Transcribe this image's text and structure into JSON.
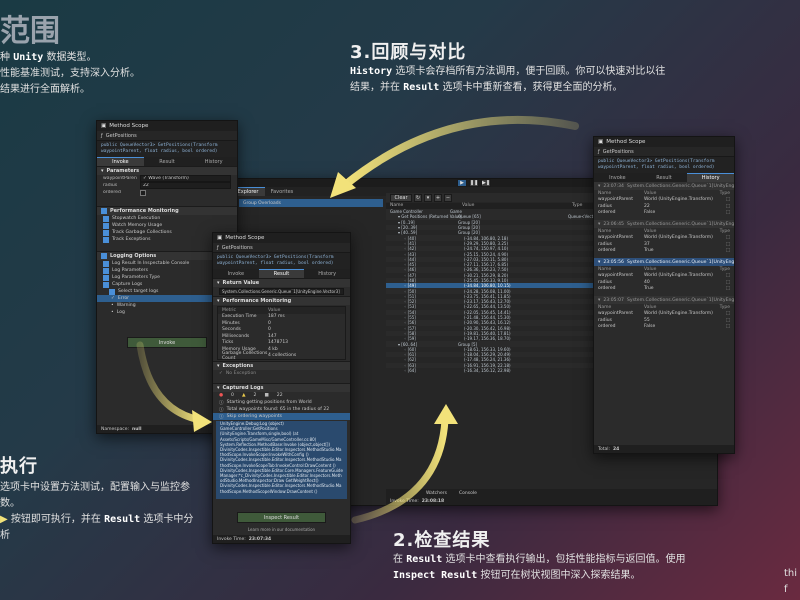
{
  "promo": {
    "corner_heading": "范围",
    "corner_line1_tail": "种",
    "corner_line1_unity": "Unity",
    "corner_line1_rest": "数据类型。",
    "corner_line2": "性能基准测试，支持深入分析。",
    "corner_line3": "结果进行全面解析。",
    "step3_title": "3.回顾与对比",
    "step3_kw1": "History",
    "step3_text1": " 选项卡会存档所有方法调用，便于回顾。你可以快速对比以往",
    "step3_text2a": "结果，并在 ",
    "step3_kw2": "Result",
    "step3_text2b": " 选项卡中重新查看，获得更全面的分析。",
    "step1_title": "执行",
    "step1_line1": "选项卡中设置方法测试，配置输入与监控参数。",
    "step1_line2a": "按钮即可执行，并在 ",
    "step1_kw": "Result",
    "step1_line2b": " 选项卡中分析",
    "step2_title": "2.检查结果",
    "step2_text1a": "在 ",
    "step2_kw1": "Result",
    "step2_text1b": " 选项卡中查看执行输出，包括性能指标与返回值。使用",
    "step2_kw2": "Inspect Result",
    "step2_text2": " 按钮可在树状视图中深入探索结果。",
    "corner_br1": "thi",
    "corner_br2": "f"
  },
  "invoke_window": {
    "title": "Method Scope",
    "method": "GetPositions",
    "code_line1": "public QueueVector3> GetPositions(Transform",
    "code_line2": "waypointParent, float radius, bool ordered)",
    "tabs": [
      "Invoke",
      "Result",
      "History"
    ],
    "parameters_label": "Parameters",
    "params": [
      {
        "name": "waypointParent",
        "value": "✓ Wave (Transform)"
      },
      {
        "name": "radius",
        "value": "22"
      },
      {
        "name": "ordered",
        "value": ""
      }
    ],
    "perf_label": "Performance Monitoring",
    "perf_options": [
      "Stopwatch Execution",
      "Watch Memory Usage",
      "Track Garbage Collections",
      "Track Exceptions"
    ],
    "logging_label": "Logging Options",
    "logging_options": [
      "Log Result In Inspectable Console",
      "Log Parameters",
      "Log Parameters Type",
      "Capture Logs"
    ],
    "select_logs": "Select target logs",
    "log_levels": [
      "Error",
      "Warning",
      "Log"
    ],
    "invoke_button": "Invoke",
    "namespace_label": "Namespace:",
    "namespace_value": "null"
  },
  "result_window": {
    "title": "Method Scope",
    "method": "GetPositions",
    "code_line1": "public QueueVector3> GetPositions(Transform",
    "code_line2": "waypointParent, float radius, bool ordered)",
    "tabs": [
      "Invoke",
      "Result",
      "History"
    ],
    "return_label": "Return Value",
    "return_value": "System.Collections.Generic.Queue`1[UnityEngine.Vector3]",
    "perf_label": "Performance Monitoring",
    "metric_header": "Metric",
    "value_header": "Value",
    "metrics": [
      {
        "name": "Execution Time",
        "value": "187 ms"
      },
      {
        "name": "Minutes",
        "value": "0"
      },
      {
        "name": "Seconds",
        "value": "0"
      },
      {
        "name": "Milliseconds",
        "value": "147"
      },
      {
        "name": "Ticks",
        "value": "1478713"
      },
      {
        "name": "Memory Usage",
        "value": "4 kb"
      },
      {
        "name": "Garbage Collections Count",
        "value": "4 collections"
      }
    ],
    "exceptions_label": "Exceptions",
    "no_exception": "No Exception",
    "captured_label": "Captured Logs",
    "log_counts": [
      "0",
      "2",
      "22"
    ],
    "log_entries": [
      "Starting getting positions from World",
      "Total waypoints found: 65 in the radius of 22",
      "Skip ordering waypoints"
    ],
    "stack": [
      "UnityEngine.Debug:Log (object)",
      "GameController:GetPositions",
      "(UnityEngine.Transform,single,bool) (at",
      "Assets/Scripts/GameMisc/GameController.cs:80)",
      "System.Reflection.MethodBase:Invoke (object,object[])",
      "DivinityCodes.Inspectible.Editor.Inspectors.MethodStudio.Ma",
      "thodScope.InvokeScope:InvokeWithConfig ()",
      "DivinityCodes.Inspectible.Editor.Inspectors.MethodStudio.Ma",
      "thodScope.InvokeScopeTab:InvokeControl:DrawContent ()",
      "DivinityCodes.Inspectible.Editor.Core.Managers.FeatureGuide",
      "Manager:*c_DivinityCodes.Inspectible.Editor.Inspectors.Meth",
      "odStudio.MethodInspector:Draw GetWeightRect()",
      "DivinityCodes.Inspectible.Editor.Inspectors.MethodStudio.Ma",
      "thodScope.MethodScopeWindow:DrawContent ()"
    ],
    "inspect_button": "Inspect Result",
    "learn_more": "Learn more in our documentation",
    "invoke_time_label": "Invoke Time:",
    "invoke_time": "23:07:34"
  },
  "tree_panel": {
    "explorer_tab": "Explorer",
    "favorites_tab": "Favorites",
    "group_overloads": "Group Overloads",
    "clear_label": "Clear",
    "col_name": "Name",
    "col_value": "Value",
    "col_type": "Type",
    "root_name": "Game Controller",
    "root_value": "Game",
    "rows": [
      {
        "name": "Get Positions (Returned Value)",
        "value": "Queue [65]",
        "type": "Queue<Vector3>"
      },
      {
        "name": "[0..19]",
        "value": "Group [20]",
        "type": ""
      },
      {
        "name": "[20..39]",
        "value": "Group [20]",
        "type": ""
      },
      {
        "name": "[40..59]",
        "value": "Group [20]",
        "type": ""
      },
      {
        "name": "[40]",
        "value": "(-34.84, 106.80, 2.18)",
        "type": ""
      },
      {
        "name": "[41]",
        "value": "(-29.29, 150.80, 3.25)",
        "type": ""
      },
      {
        "name": "[42]",
        "value": "(-24.74, 150.97, 4.10)",
        "type": ""
      },
      {
        "name": "[43]",
        "value": "(-25.15, 150.24, 4.90)",
        "type": ""
      },
      {
        "name": "[44]",
        "value": "(-27.03, 150.11, 5.80)",
        "type": ""
      },
      {
        "name": "[45]",
        "value": "(-27.11, 156.17, 6.85)",
        "type": ""
      },
      {
        "name": "[46]",
        "value": "(-26.36, 156.23, 7.50)",
        "type": ""
      },
      {
        "name": "[47]",
        "value": "(-30.21, 156.29, 8.20)",
        "type": ""
      },
      {
        "name": "[48]",
        "value": "(-25.45, 156.33, 9.10)",
        "type": ""
      },
      {
        "name": "[49]",
        "value": "(-34.84, 106.80, 10.15)",
        "type": ""
      },
      {
        "name": "[50]",
        "value": "(-24.28, 156.08, 11.00)",
        "type": ""
      },
      {
        "name": "[51]",
        "value": "(-23.75, 156.41, 11.85)",
        "type": ""
      },
      {
        "name": "[52]",
        "value": "(-23.17, 156.43, 12.70)",
        "type": ""
      },
      {
        "name": "[53]",
        "value": "(-22.65, 156.44, 13.50)",
        "type": ""
      },
      {
        "name": "[54]",
        "value": "(-22.05, 156.45, 14.41)",
        "type": ""
      },
      {
        "name": "[55]",
        "value": "(-21.48, 156.44, 15.30)",
        "type": ""
      },
      {
        "name": "[56]",
        "value": "(-20.90, 156.43, 16.12)",
        "type": ""
      },
      {
        "name": "[57]",
        "value": "(-20.30, 156.42, 16.98)",
        "type": ""
      },
      {
        "name": "[58]",
        "value": "(-19.81, 156.40, 17.81)",
        "type": ""
      },
      {
        "name": "[59]",
        "value": "(-19.17, 156.36, 18.70)",
        "type": ""
      },
      {
        "name": "[60..64]",
        "value": "Group [5]",
        "type": ""
      },
      {
        "name": "[60]",
        "value": "(-18.61, 156.33, 19.60)",
        "type": ""
      },
      {
        "name": "[61]",
        "value": "(-18.04, 156.29, 20.49)",
        "type": ""
      },
      {
        "name": "[62]",
        "value": "(-17.48, 156.24, 21.36)",
        "type": ""
      },
      {
        "name": "[63]",
        "value": "(-16.91, 156.19, 22.18)",
        "type": ""
      },
      {
        "name": "[64]",
        "value": "(-16.34, 156.12, 22.98)",
        "type": ""
      }
    ],
    "bottom_tabs": [
      "Watchers",
      "Console"
    ],
    "invoke_time_label": "Invoke Time:",
    "invoke_time": "23:08:18"
  },
  "history_window": {
    "title": "Method Scope",
    "method": "GetPositions",
    "code_line1": "public QueueVector3> GetPositions(Transform",
    "code_line2": "waypointParent, float radius, bool ordered)",
    "tabs": [
      "Invoke",
      "Result",
      "History"
    ],
    "col_name": "Name",
    "col_value": "Value",
    "col_type": "Type",
    "entries": [
      {
        "time": "23:07:34",
        "type": "System.Collections.Generic.Queue`1[UnityEngine.V",
        "active": false,
        "rows": [
          [
            "waypointParent",
            "World (UnityEngine.Transform)"
          ],
          [
            "radius",
            "22"
          ],
          [
            "ordered",
            "False"
          ]
        ]
      },
      {
        "time": "23:06:45",
        "type": "System.Collections.Generic.Queue`1[UnityEngine.V",
        "active": false,
        "rows": [
          [
            "waypointParent",
            "World (UnityEngine.Transform)"
          ],
          [
            "radius",
            "37"
          ],
          [
            "ordered",
            "True"
          ]
        ]
      },
      {
        "time": "23:05:56",
        "type": "System.Collections.Generic.Queue`1[UnityEngine.V",
        "active": true,
        "rows": [
          [
            "waypointParent",
            "World (UnityEngine.Transform)"
          ],
          [
            "radius",
            "40"
          ],
          [
            "ordered",
            "True"
          ]
        ]
      },
      {
        "time": "23:05:07",
        "type": "System.Collections.Generic.Queue`1[UnityEngine.V",
        "active": false,
        "rows": [
          [
            "waypointParent",
            "World (UnityEngine.Transform)"
          ],
          [
            "radius",
            "55"
          ],
          [
            "ordered",
            "False"
          ]
        ]
      }
    ],
    "total_label": "Total:",
    "total_value": "24"
  },
  "colors": {
    "accent": "#4a8fd8",
    "selection": "#2e5f8f",
    "arrow": "#f2e27a"
  }
}
